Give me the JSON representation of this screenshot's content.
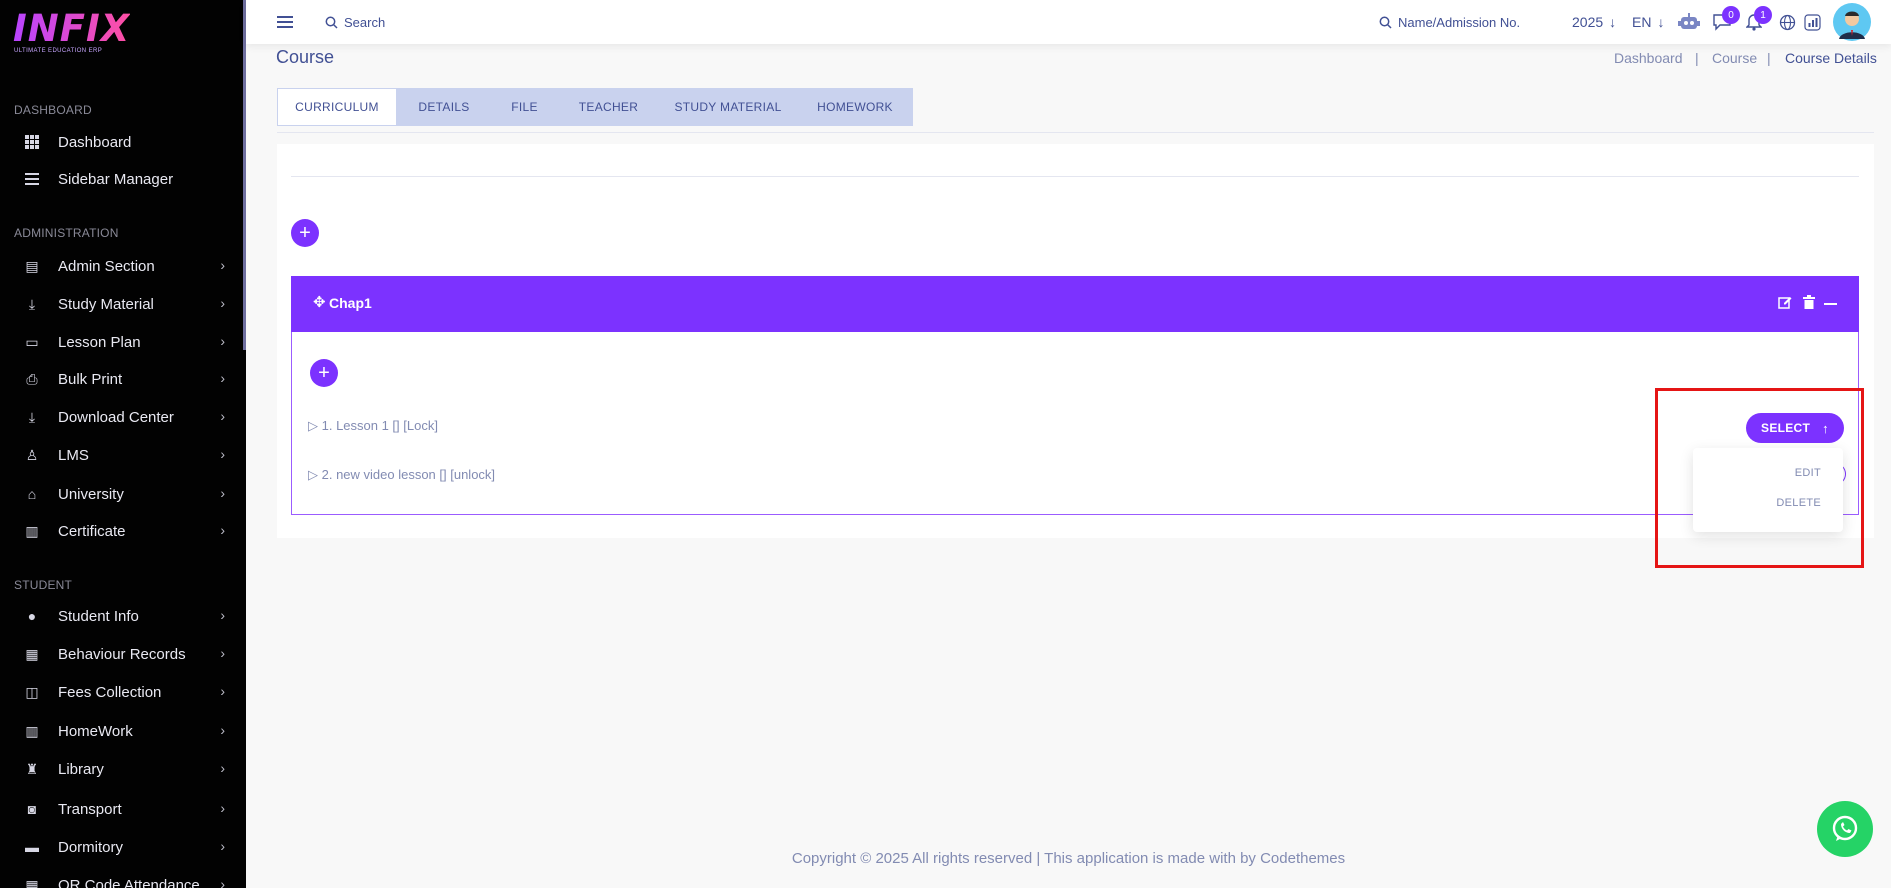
{
  "sidebar": {
    "logo": "INFIX",
    "tagline": "ULTIMATE EDUCATION ERP",
    "sections": [
      {
        "title": "DASHBOARD",
        "items": [
          {
            "label": "Dashboard",
            "icon": "grid-icon"
          },
          {
            "label": "Sidebar Manager",
            "icon": "menu-icon"
          }
        ]
      },
      {
        "title": "ADMINISTRATION",
        "items": [
          {
            "label": "Admin Section",
            "icon": "admin-icon"
          },
          {
            "label": "Study Material",
            "icon": "download-icon"
          },
          {
            "label": "Lesson Plan",
            "icon": "lesson-icon"
          },
          {
            "label": "Bulk Print",
            "icon": "printer-icon"
          },
          {
            "label": "Download Center",
            "icon": "download-icon"
          },
          {
            "label": "LMS",
            "icon": "lms-icon"
          },
          {
            "label": "University",
            "icon": "university-icon"
          },
          {
            "label": "Certificate",
            "icon": "book-icon"
          }
        ]
      },
      {
        "title": "STUDENT",
        "items": [
          {
            "label": "Student Info",
            "icon": "user-icon"
          },
          {
            "label": "Behaviour Records",
            "icon": "records-icon"
          },
          {
            "label": "Fees Collection",
            "icon": "fees-icon"
          },
          {
            "label": "HomeWork",
            "icon": "book-icon"
          },
          {
            "label": "Library",
            "icon": "library-icon"
          },
          {
            "label": "Transport",
            "icon": "bus-icon"
          },
          {
            "label": "Dormitory",
            "icon": "bed-icon"
          },
          {
            "label": "QR Code Attendance",
            "icon": "qr-icon"
          }
        ]
      }
    ]
  },
  "topbar": {
    "search_label": "Search",
    "student_search_label": "Name/Admission No.",
    "year": "2025",
    "language": "EN",
    "messages_count": "0",
    "notifications_count": "1"
  },
  "page": {
    "title": "Course",
    "breadcrumb": [
      "Dashboard",
      "Course",
      "Course Details"
    ],
    "tabs": [
      "CURRICULUM",
      "DETAILS",
      "FILE",
      "TEACHER",
      "STUDY MATERIAL",
      "HOMEWORK"
    ],
    "active_tab": "CURRICULUM"
  },
  "chapter": {
    "title": "Chap1",
    "lessons": [
      "1. Lesson 1 [] [Lock]",
      "2. new video lesson [] [unlock]"
    ]
  },
  "action": {
    "select_label": "SELECT",
    "menu_items": [
      "EDIT",
      "DELETE"
    ]
  },
  "footer": {
    "text": "Copyright © 2025 All rights reserved | This application is made with by Codethemes"
  },
  "colors": {
    "accent": "#7c32ff",
    "sidebar_bg": "#020202",
    "highlight": "#e51515",
    "whatsapp": "#25d366"
  }
}
